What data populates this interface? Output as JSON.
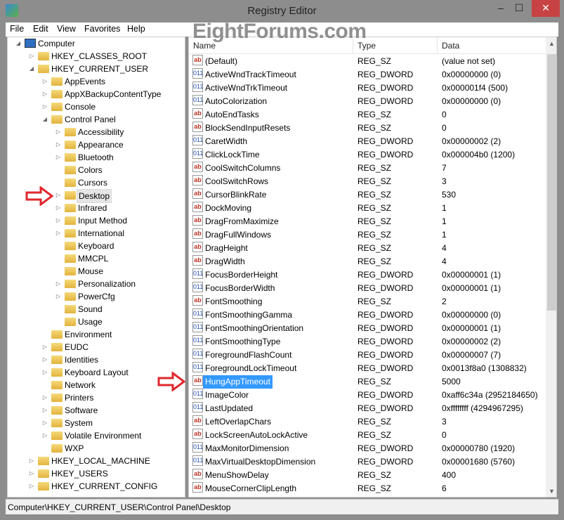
{
  "window": {
    "title": "Registry Editor",
    "minimize": "–",
    "maximize": "☐",
    "close": "✕"
  },
  "menu": [
    "File",
    "Edit",
    "View",
    "Favorites",
    "Help"
  ],
  "watermark": "EightForums.com",
  "tree": [
    {
      "label": "Computer",
      "level": 0,
      "state": "expanded",
      "icon": "computer-icon"
    },
    {
      "label": "HKEY_CLASSES_ROOT",
      "level": 1,
      "state": "collapsed"
    },
    {
      "label": "HKEY_CURRENT_USER",
      "level": 1,
      "state": "expanded"
    },
    {
      "label": "AppEvents",
      "level": 2,
      "state": "collapsed"
    },
    {
      "label": "AppXBackupContentType",
      "level": 2,
      "state": "collapsed"
    },
    {
      "label": "Console",
      "level": 2,
      "state": "collapsed"
    },
    {
      "label": "Control Panel",
      "level": 2,
      "state": "expanded"
    },
    {
      "label": "Accessibility",
      "level": 3,
      "state": "collapsed"
    },
    {
      "label": "Appearance",
      "level": 3,
      "state": "collapsed"
    },
    {
      "label": "Bluetooth",
      "level": 3,
      "state": "collapsed"
    },
    {
      "label": "Colors",
      "level": 3,
      "state": "leaf"
    },
    {
      "label": "Cursors",
      "level": 3,
      "state": "leaf"
    },
    {
      "label": "Desktop",
      "level": 3,
      "state": "collapsed",
      "selected": true
    },
    {
      "label": "Infrared",
      "level": 3,
      "state": "collapsed"
    },
    {
      "label": "Input Method",
      "level": 3,
      "state": "collapsed"
    },
    {
      "label": "International",
      "level": 3,
      "state": "collapsed"
    },
    {
      "label": "Keyboard",
      "level": 3,
      "state": "leaf"
    },
    {
      "label": "MMCPL",
      "level": 3,
      "state": "leaf"
    },
    {
      "label": "Mouse",
      "level": 3,
      "state": "leaf"
    },
    {
      "label": "Personalization",
      "level": 3,
      "state": "collapsed"
    },
    {
      "label": "PowerCfg",
      "level": 3,
      "state": "collapsed"
    },
    {
      "label": "Sound",
      "level": 3,
      "state": "leaf"
    },
    {
      "label": "Usage",
      "level": 3,
      "state": "leaf"
    },
    {
      "label": "Environment",
      "level": 2,
      "state": "leaf"
    },
    {
      "label": "EUDC",
      "level": 2,
      "state": "collapsed"
    },
    {
      "label": "Identities",
      "level": 2,
      "state": "collapsed"
    },
    {
      "label": "Keyboard Layout",
      "level": 2,
      "state": "collapsed"
    },
    {
      "label": "Network",
      "level": 2,
      "state": "leaf"
    },
    {
      "label": "Printers",
      "level": 2,
      "state": "collapsed"
    },
    {
      "label": "Software",
      "level": 2,
      "state": "collapsed"
    },
    {
      "label": "System",
      "level": 2,
      "state": "collapsed"
    },
    {
      "label": "Volatile Environment",
      "level": 2,
      "state": "collapsed"
    },
    {
      "label": "WXP",
      "level": 2,
      "state": "leaf"
    },
    {
      "label": "HKEY_LOCAL_MACHINE",
      "level": 1,
      "state": "collapsed"
    },
    {
      "label": "HKEY_USERS",
      "level": 1,
      "state": "collapsed"
    },
    {
      "label": "HKEY_CURRENT_CONFIG",
      "level": 1,
      "state": "collapsed"
    }
  ],
  "columns": {
    "name": "Name",
    "type": "Type",
    "data": "Data"
  },
  "values": [
    [
      "(Default)",
      "REG_SZ",
      "(value not set)"
    ],
    [
      "ActiveWndTrackTimeout",
      "REG_DWORD",
      "0x00000000 (0)"
    ],
    [
      "ActiveWndTrkTimeout",
      "REG_DWORD",
      "0x000001f4 (500)"
    ],
    [
      "AutoColorization",
      "REG_DWORD",
      "0x00000000 (0)"
    ],
    [
      "AutoEndTasks",
      "REG_SZ",
      "0"
    ],
    [
      "BlockSendInputResets",
      "REG_SZ",
      "0"
    ],
    [
      "CaretWidth",
      "REG_DWORD",
      "0x00000002 (2)"
    ],
    [
      "ClickLockTime",
      "REG_DWORD",
      "0x000004b0 (1200)"
    ],
    [
      "CoolSwitchColumns",
      "REG_SZ",
      "7"
    ],
    [
      "CoolSwitchRows",
      "REG_SZ",
      "3"
    ],
    [
      "CursorBlinkRate",
      "REG_SZ",
      "530"
    ],
    [
      "DockMoving",
      "REG_SZ",
      "1"
    ],
    [
      "DragFromMaximize",
      "REG_SZ",
      "1"
    ],
    [
      "DragFullWindows",
      "REG_SZ",
      "1"
    ],
    [
      "DragHeight",
      "REG_SZ",
      "4"
    ],
    [
      "DragWidth",
      "REG_SZ",
      "4"
    ],
    [
      "FocusBorderHeight",
      "REG_DWORD",
      "0x00000001 (1)"
    ],
    [
      "FocusBorderWidth",
      "REG_DWORD",
      "0x00000001 (1)"
    ],
    [
      "FontSmoothing",
      "REG_SZ",
      "2"
    ],
    [
      "FontSmoothingGamma",
      "REG_DWORD",
      "0x00000000 (0)"
    ],
    [
      "FontSmoothingOrientation",
      "REG_DWORD",
      "0x00000001 (1)"
    ],
    [
      "FontSmoothingType",
      "REG_DWORD",
      "0x00000002 (2)"
    ],
    [
      "ForegroundFlashCount",
      "REG_DWORD",
      "0x00000007 (7)"
    ],
    [
      "ForegroundLockTimeout",
      "REG_DWORD",
      "0x0013f8a0 (1308832)"
    ],
    [
      "HungAppTimeout",
      "REG_SZ",
      "5000"
    ],
    [
      "ImageColor",
      "REG_DWORD",
      "0xaff6c34a (2952184650)"
    ],
    [
      "LastUpdated",
      "REG_DWORD",
      "0xffffffff (4294967295)"
    ],
    [
      "LeftOverlapChars",
      "REG_SZ",
      "3"
    ],
    [
      "LockScreenAutoLockActive",
      "REG_SZ",
      "0"
    ],
    [
      "MaxMonitorDimension",
      "REG_DWORD",
      "0x00000780 (1920)"
    ],
    [
      "MaxVirtualDesktopDimension",
      "REG_DWORD",
      "0x00001680 (5760)"
    ],
    [
      "MenuShowDelay",
      "REG_SZ",
      "400"
    ],
    [
      "MouseCornerClipLength",
      "REG_SZ",
      "6"
    ]
  ],
  "selected_value": "HungAppTimeout",
  "status": "Computer\\HKEY_CURRENT_USER\\Control Panel\\Desktop",
  "colors": {
    "selection": "#3399ff",
    "close_button": "#c74343",
    "arrow": "#e0282d"
  }
}
